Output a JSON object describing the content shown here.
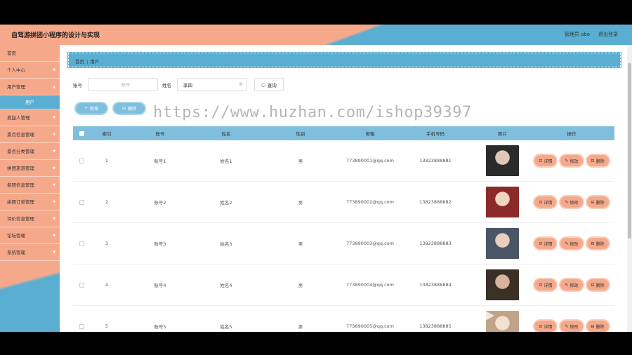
{
  "app": {
    "title": "自驾游拼团小程序的设计与实现",
    "user": "管理员 abo",
    "logout": "退出登录"
  },
  "sidebar": {
    "items": [
      {
        "label": "首页",
        "chevron": false
      },
      {
        "label": "个人中心",
        "chevron": true
      },
      {
        "label": "用户管理",
        "chevron": true
      },
      {
        "label": "发起人管理",
        "chevron": true
      },
      {
        "label": "景点信息管理",
        "chevron": true
      },
      {
        "label": "景点分类管理",
        "chevron": true
      },
      {
        "label": "拼团旅游管理",
        "chevron": true
      },
      {
        "label": "参团信息管理",
        "chevron": true
      },
      {
        "label": "拼团订单管理",
        "chevron": true
      },
      {
        "label": "评价信息管理",
        "chevron": true
      },
      {
        "label": "论坛管理",
        "chevron": true
      },
      {
        "label": "系统管理",
        "chevron": true
      }
    ],
    "sub_item": "用户"
  },
  "breadcrumb": {
    "home": "首页",
    "current": "用户"
  },
  "search": {
    "account_label": "账号",
    "account_placeholder": "账号",
    "name_label": "姓名",
    "name_value": "李四",
    "query_label": "查询"
  },
  "actions": {
    "add_label": "新增",
    "delete_label": "删除"
  },
  "watermark": "https://www.huzhan.com/ishop39397",
  "table": {
    "headers": {
      "index": "索引",
      "account": "账号",
      "name": "姓名",
      "gender": "性别",
      "email": "邮箱",
      "phone": "手机号码",
      "photo": "照片",
      "ops": "操作"
    },
    "rows": [
      {
        "index": "1",
        "account": "账号1",
        "name": "姓名1",
        "gender": "男",
        "email": "773890001@qq.com",
        "phone": "13823888881"
      },
      {
        "index": "2",
        "account": "账号2",
        "name": "姓名2",
        "gender": "男",
        "email": "773890002@qq.com",
        "phone": "13823888882"
      },
      {
        "index": "3",
        "account": "账号3",
        "name": "姓名3",
        "gender": "男",
        "email": "773890003@qq.com",
        "phone": "13823888883"
      },
      {
        "index": "4",
        "account": "账号4",
        "name": "姓名4",
        "gender": "男",
        "email": "773890004@qq.com",
        "phone": "13823888884"
      },
      {
        "index": "5",
        "account": "账号5",
        "name": "姓名5",
        "gender": "男",
        "email": "773890005@qq.com",
        "phone": "13823888885"
      }
    ],
    "op_labels": {
      "detail": "详情",
      "edit": "修改",
      "delete": "删除"
    }
  },
  "colors": {
    "peach": "#f5a98a",
    "blue": "#5aaed1",
    "header_blue": "#7fbfdd"
  }
}
